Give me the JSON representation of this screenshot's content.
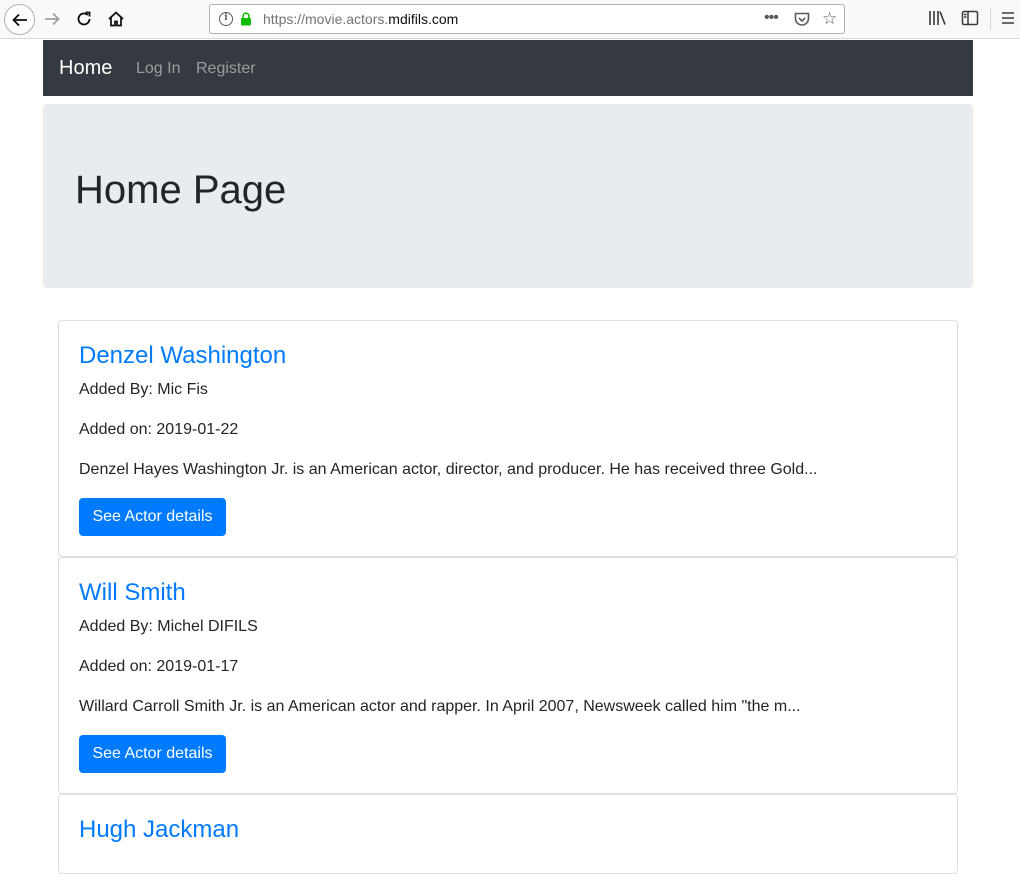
{
  "browser": {
    "url_prefix": "https://movie.actors.",
    "url_host": "mdifils.com",
    "more_label": "•••"
  },
  "navbar": {
    "brand": "Home",
    "links": [
      "Log In",
      "Register"
    ]
  },
  "jumbotron": {
    "title": "Home Page"
  },
  "actors": [
    {
      "name": "Denzel Washington",
      "added_by": "Added By: Mic Fis",
      "added_on": "Added on: 2019-01-22",
      "description": "Denzel Hayes Washington Jr. is an American actor, director, and producer. He has received three Gold...",
      "button": "See Actor details"
    },
    {
      "name": "Will Smith",
      "added_by": "Added By: Michel DIFILS",
      "added_on": "Added on: 2019-01-17",
      "description": "Willard Carroll Smith Jr. is an American actor and rapper. In April 2007, Newsweek called him \"the m...",
      "button": "See Actor details"
    },
    {
      "name": "Hugh Jackman"
    }
  ],
  "icons": {
    "back": "arrow-left-icon",
    "forward": "arrow-right-icon",
    "reload": "reload-icon",
    "home": "home-icon",
    "info": "info-icon",
    "lock": "lock-icon",
    "pocket": "pocket-icon",
    "bookmark": "star-icon",
    "library": "library-icon",
    "sidebar": "sidebar-icon",
    "menu": "hamburger-menu-icon"
  },
  "colors": {
    "navbar_bg": "#343a40",
    "jumbotron_bg": "#e9ecef",
    "link_blue": "#007bff",
    "button_bg": "#007bff",
    "lock_green": "#12bc00"
  }
}
